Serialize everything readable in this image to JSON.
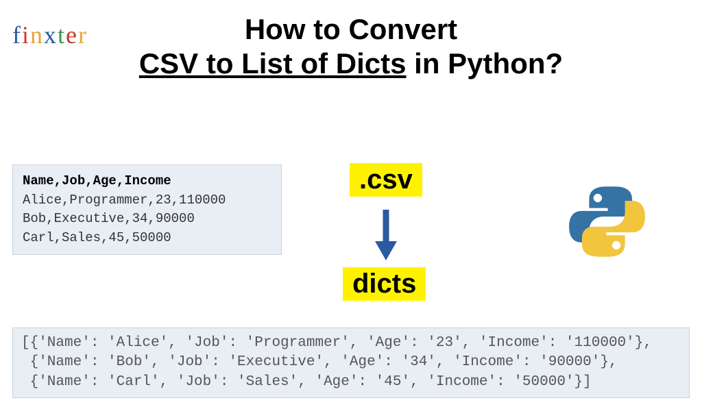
{
  "logo": {
    "f": "f",
    "i": "i",
    "n": "n",
    "x": "x",
    "t": "t",
    "e": "e",
    "r": "r"
  },
  "title": {
    "line1": "How to Convert",
    "underline": "CSV to List of Dicts",
    "line2_suffix": " in Python?"
  },
  "csv": {
    "header": "Name,Job,Age,Income",
    "row1": "Alice,Programmer,23,110000",
    "row2": "Bob,Executive,34,90000",
    "row3": "Carl,Sales,45,50000"
  },
  "labels": {
    "csv": ".csv",
    "dicts": "dicts"
  },
  "output": {
    "line1": "[{'Name': 'Alice', 'Job': 'Programmer', 'Age': '23', 'Income': '110000'},",
    "line2": " {'Name': 'Bob', 'Job': 'Executive', 'Age': '34', 'Income': '90000'},",
    "line3": " {'Name': 'Carl', 'Job': 'Sales', 'Age': '45', 'Income': '50000'}]"
  }
}
